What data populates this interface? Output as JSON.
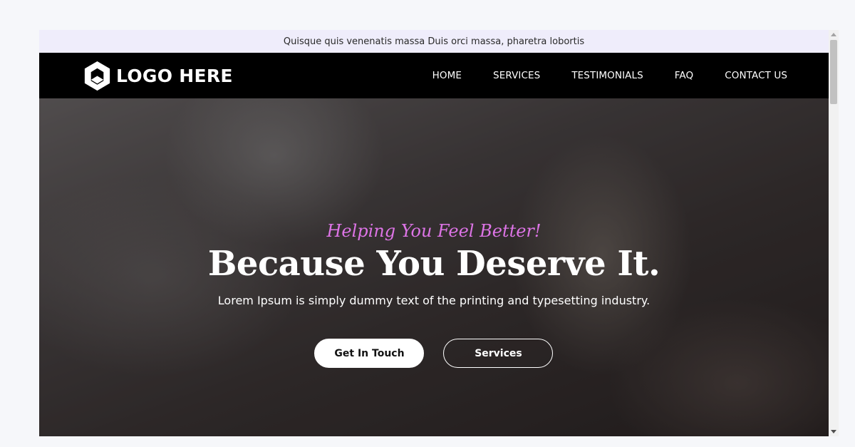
{
  "topbar": {
    "text": "Quisque quis venenatis massa Duis orci massa, pharetra lobortis"
  },
  "header": {
    "logo_text": "LOGO HERE",
    "logo_icon": "hexagon-logo-icon",
    "nav": [
      {
        "label": "HOME"
      },
      {
        "label": "SERVICES"
      },
      {
        "label": "TESTIMONIALS"
      },
      {
        "label": "FAQ"
      },
      {
        "label": "CONTACT US"
      }
    ]
  },
  "hero": {
    "tagline": "Helping You Feel Better!",
    "headline": "Because You Deserve It.",
    "subtext": "Lorem Ipsum is simply dummy text of the printing and typesetting industry.",
    "primary_button": "Get In Touch",
    "secondary_button": "Services"
  },
  "colors": {
    "topbar_bg": "#efedfb",
    "navbar_bg": "#000000",
    "tagline": "#dd74e6",
    "text_light": "#ffffff"
  }
}
